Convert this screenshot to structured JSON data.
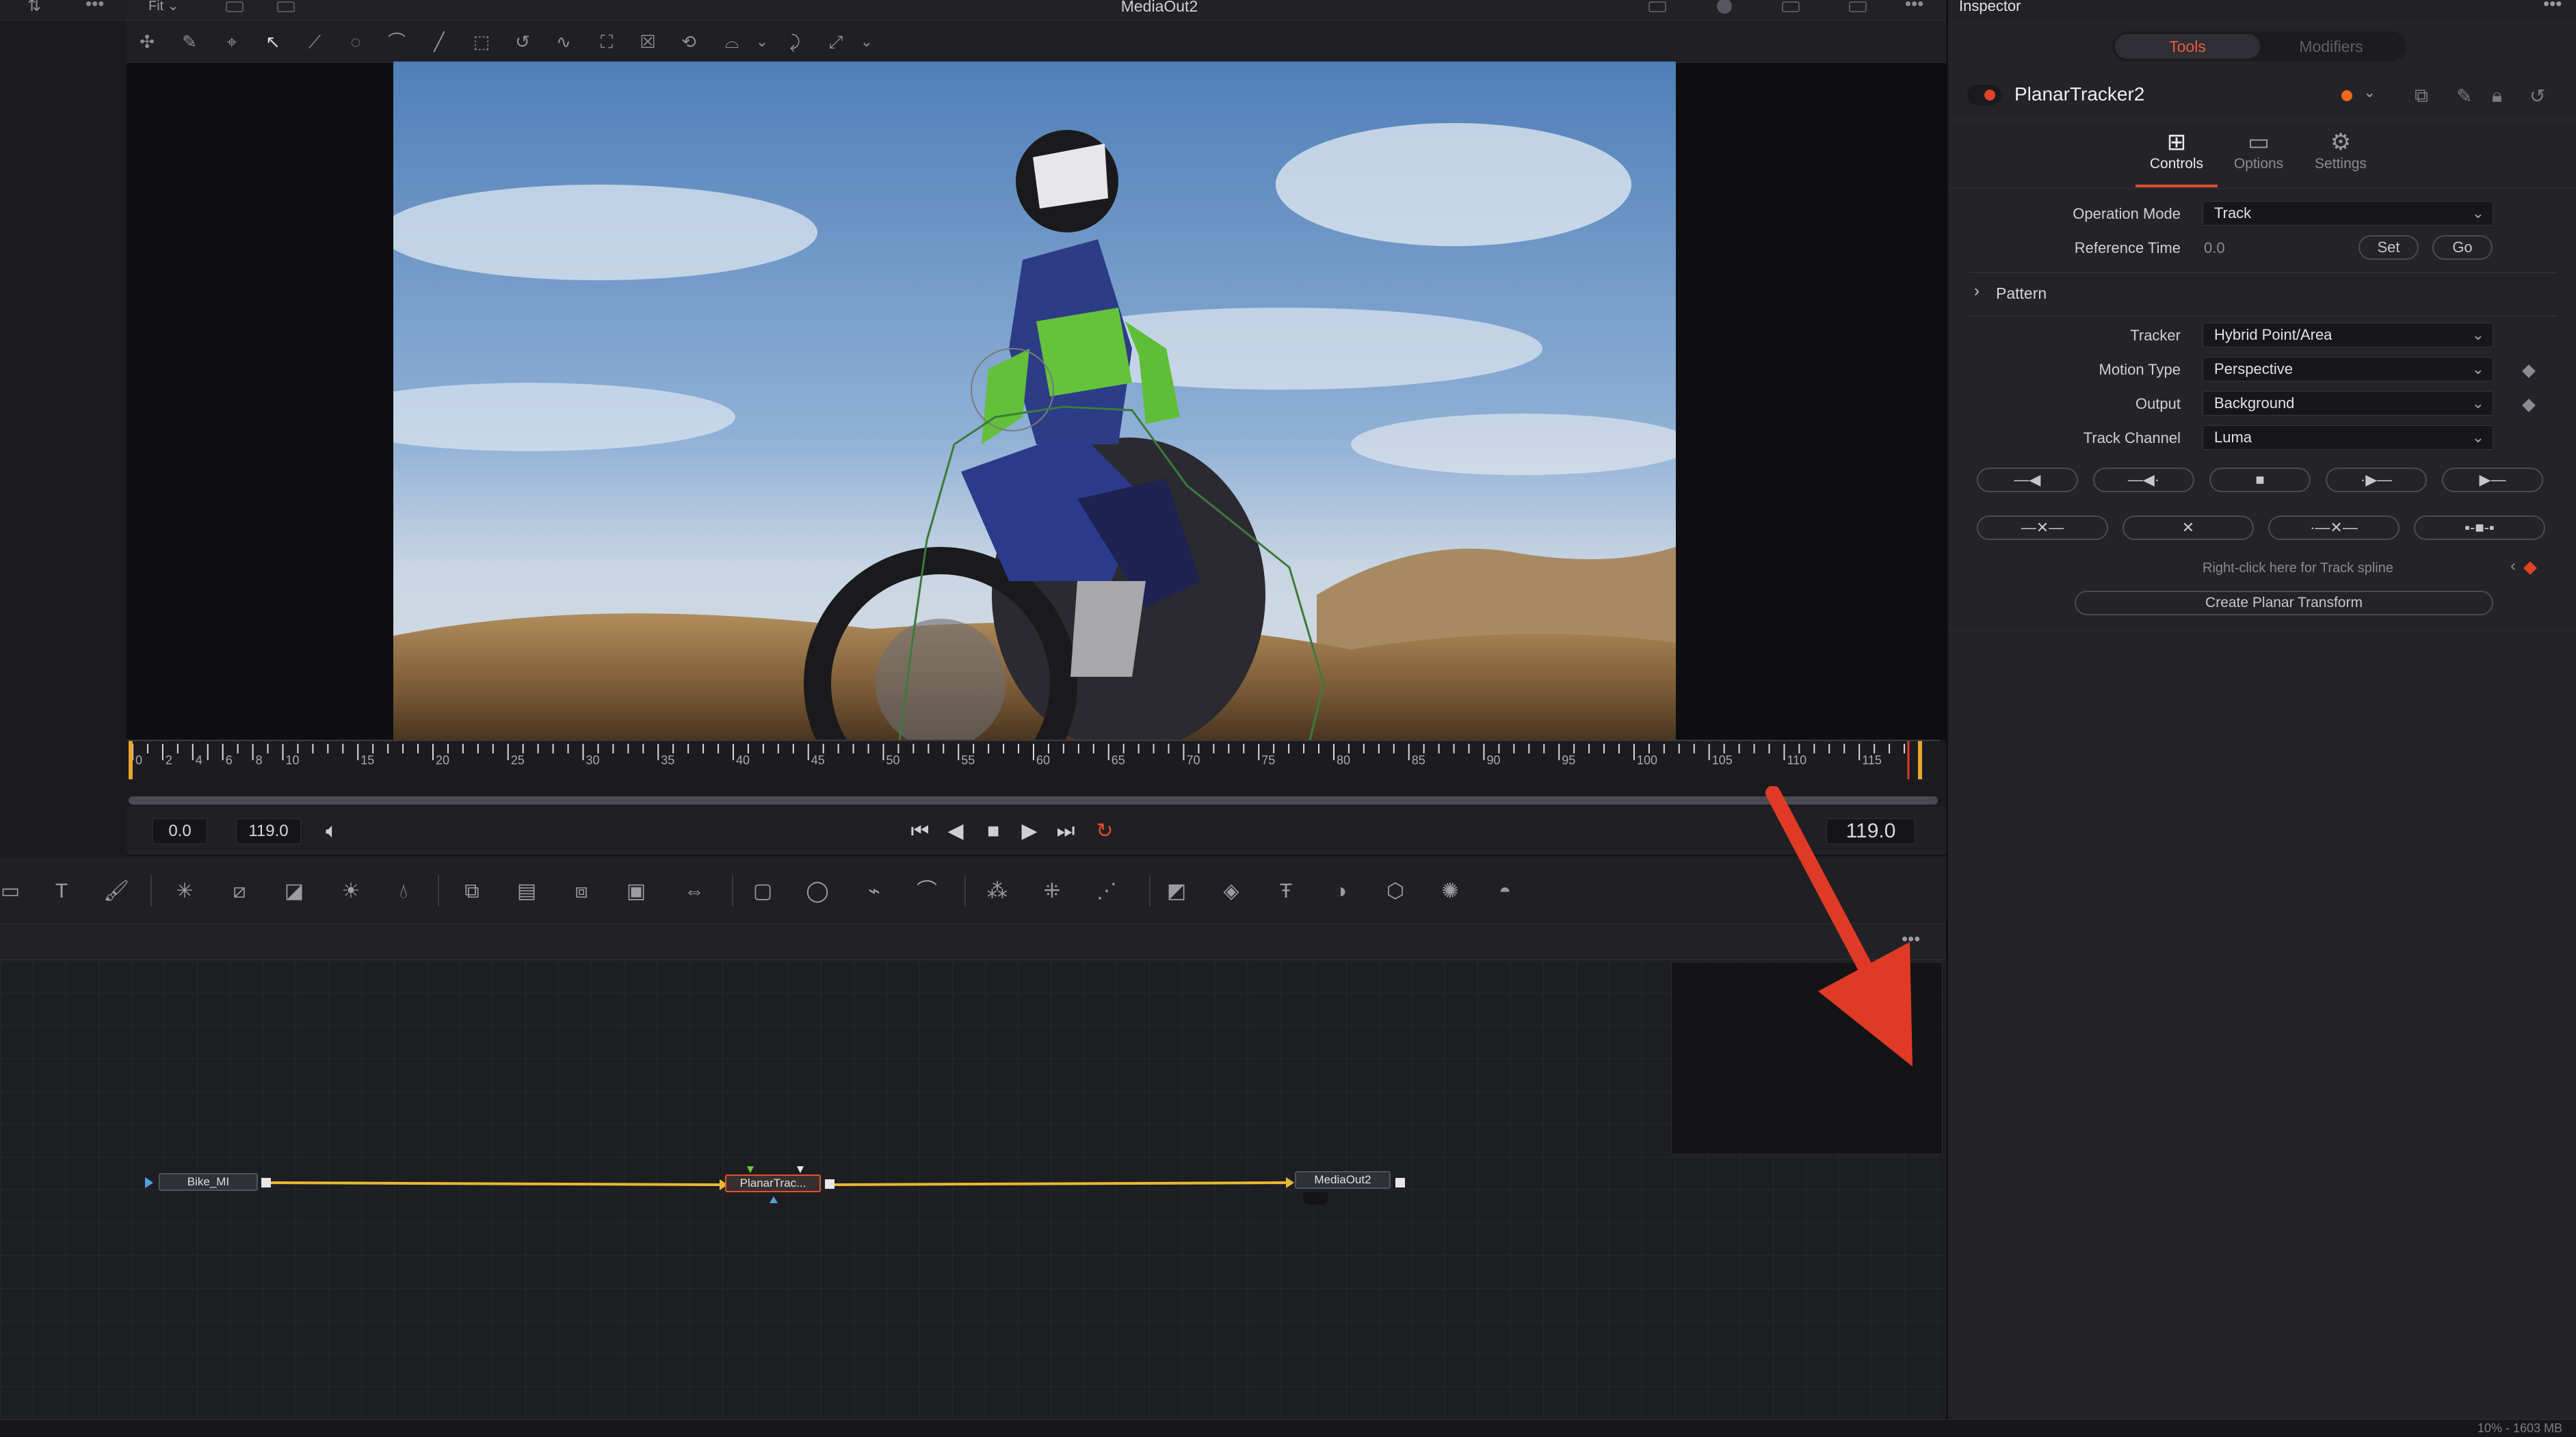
{
  "viewer": {
    "left_menu": "Fit",
    "title": "MediaOut2",
    "time_start": "0.0",
    "time_end": "119.0",
    "current_time": "119.0",
    "ruler_ticks": [
      "0",
      "2",
      "4",
      "6",
      "8",
      "10",
      "15",
      "20",
      "25",
      "30",
      "35",
      "40",
      "45",
      "50",
      "55",
      "60",
      "65",
      "70",
      "75",
      "80",
      "85",
      "90",
      "95",
      "100",
      "105",
      "110",
      "115"
    ]
  },
  "node_editor": {
    "nodes": {
      "bike": "Bike_MI",
      "tracker": "PlanarTrac...",
      "out": "MediaOut2"
    }
  },
  "inspector": {
    "title": "Inspector",
    "segments": {
      "tools": "Tools",
      "modifiers": "Modifiers"
    },
    "tool_name": "PlanarTracker2",
    "tabs": {
      "controls": "Controls",
      "options": "Options",
      "settings": "Settings"
    },
    "fields": {
      "operation_mode": {
        "label": "Operation Mode",
        "value": "Track"
      },
      "reference_time": {
        "label": "Reference Time",
        "value": "0.0",
        "set": "Set",
        "go": "Go"
      },
      "pattern": "Pattern",
      "tracker": {
        "label": "Tracker",
        "value": "Hybrid Point/Area"
      },
      "motion_type": {
        "label": "Motion Type",
        "value": "Perspective"
      },
      "output": {
        "label": "Output",
        "value": "Background"
      },
      "track_channel": {
        "label": "Track Channel",
        "value": "Luma"
      }
    },
    "track_spline_hint": "Right-click here for Track spline",
    "create_button": "Create Planar Transform"
  },
  "status": {
    "text": "10% - 1603 MB"
  },
  "colors": {
    "accent": "#e04a2c",
    "connection": "#e8b830",
    "annotation_arrow": "#e03a26"
  }
}
